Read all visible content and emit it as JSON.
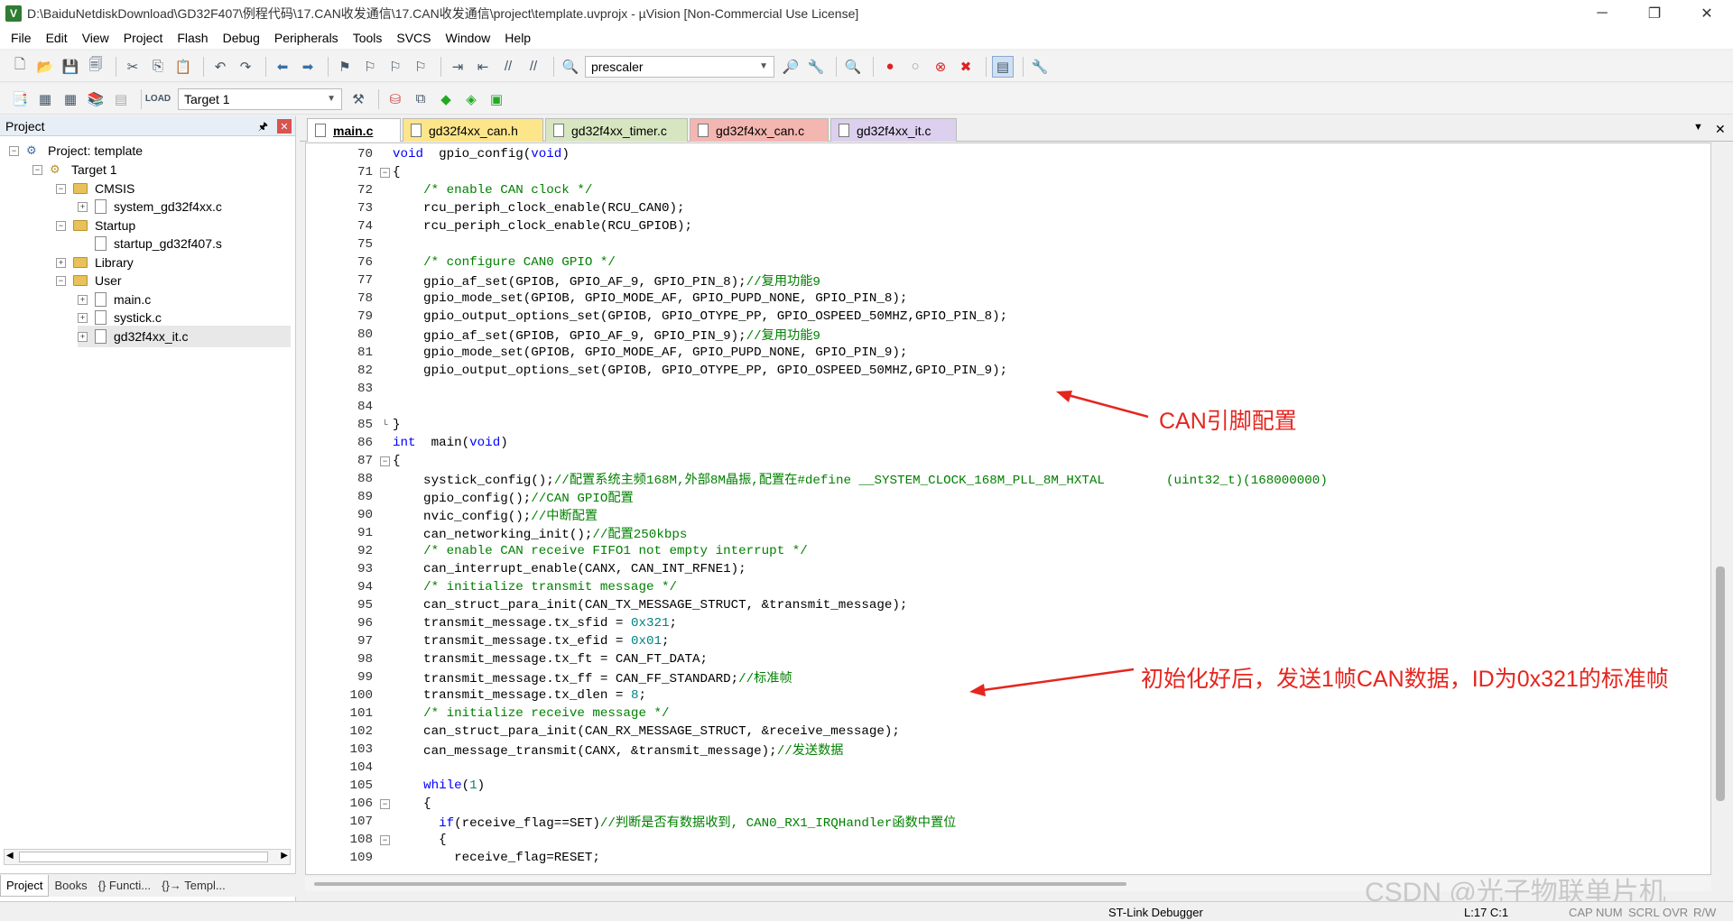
{
  "window": {
    "title": "D:\\BaiduNetdiskDownload\\GD32F407\\例程代码\\17.CAN收发通信\\17.CAN收发通信\\project\\template.uvprojx - µVision  [Non-Commercial Use License]",
    "app_icon": "V",
    "minimize_label": "─",
    "maximize_label": "❐",
    "close_label": "✕"
  },
  "menu": [
    "File",
    "Edit",
    "View",
    "Project",
    "Flash",
    "Debug",
    "Peripherals",
    "Tools",
    "SVCS",
    "Window",
    "Help"
  ],
  "toolbar1": {
    "search_combo_value": "prescaler"
  },
  "toolbar2": {
    "target_combo_value": "Target 1"
  },
  "project_panel": {
    "title": "Project",
    "pin_label": "🖈",
    "close_label": "✕",
    "tree": [
      {
        "label": "Project: template",
        "exp": "−"
      },
      {
        "label": "Target 1",
        "exp": "−"
      },
      {
        "label": "CMSIS",
        "exp": "−"
      },
      {
        "label": "system_gd32f4xx.c",
        "exp": "+"
      },
      {
        "label": "Startup",
        "exp": "−"
      },
      {
        "label": "startup_gd32f407.s",
        "exp": ""
      },
      {
        "label": "Library",
        "exp": "+"
      },
      {
        "label": "User",
        "exp": "−"
      },
      {
        "label": "main.c",
        "exp": "+"
      },
      {
        "label": "systick.c",
        "exp": "+"
      },
      {
        "label": "gd32f4xx_it.c",
        "exp": "+"
      }
    ],
    "bottom_tabs": [
      "Project",
      "Books",
      "{} Functi...",
      "{}→ Templ..."
    ]
  },
  "editor_tabs": [
    {
      "label": "main.c",
      "color": "#ffffff"
    },
    {
      "label": "gd32f4xx_can.h",
      "color": "#fde58a"
    },
    {
      "label": "gd32f4xx_timer.c",
      "color": "#d7e6c0"
    },
    {
      "label": "gd32f4xx_can.c",
      "color": "#f4b6b0"
    },
    {
      "label": "gd32f4xx_it.c",
      "color": "#dcd0ee"
    }
  ],
  "tab_controls": {
    "dropdown": "▼",
    "close": "✕"
  },
  "code_lines": [
    {
      "n": "70",
      "fold": "",
      "segs": [
        [
          "kw",
          "void"
        ],
        [
          "",
          "  gpio_config("
        ],
        [
          "kw",
          "void"
        ],
        [
          "",
          ")"
        ]
      ]
    },
    {
      "n": "71",
      "fold": "−",
      "segs": [
        [
          "",
          "{"
        ]
      ]
    },
    {
      "n": "72",
      "fold": "",
      "segs": [
        [
          "",
          "    "
        ],
        [
          "cm",
          "/* enable CAN clock */"
        ]
      ]
    },
    {
      "n": "73",
      "fold": "",
      "segs": [
        [
          "",
          "    rcu_periph_clock_enable(RCU_CAN0);"
        ]
      ]
    },
    {
      "n": "74",
      "fold": "",
      "segs": [
        [
          "",
          "    rcu_periph_clock_enable(RCU_GPIOB);"
        ]
      ]
    },
    {
      "n": "75",
      "fold": "",
      "segs": [
        [
          "",
          ""
        ]
      ]
    },
    {
      "n": "76",
      "fold": "",
      "segs": [
        [
          "",
          "    "
        ],
        [
          "cm",
          "/* configure CAN0 GPIO */"
        ]
      ]
    },
    {
      "n": "77",
      "fold": "",
      "segs": [
        [
          "",
          "    gpio_af_set(GPIOB, GPIO_AF_9, GPIO_PIN_8);"
        ],
        [
          "cm",
          "//复用功能9"
        ]
      ]
    },
    {
      "n": "78",
      "fold": "",
      "segs": [
        [
          "",
          "    gpio_mode_set(GPIOB, GPIO_MODE_AF, GPIO_PUPD_NONE, GPIO_PIN_8);"
        ]
      ]
    },
    {
      "n": "79",
      "fold": "",
      "segs": [
        [
          "",
          "    gpio_output_options_set(GPIOB, GPIO_OTYPE_PP, GPIO_OSPEED_50MHZ,GPIO_PIN_8);"
        ]
      ]
    },
    {
      "n": "80",
      "fold": "",
      "segs": [
        [
          "",
          "    gpio_af_set(GPIOB, GPIO_AF_9, GPIO_PIN_9);"
        ],
        [
          "cm",
          "//复用功能9"
        ]
      ]
    },
    {
      "n": "81",
      "fold": "",
      "segs": [
        [
          "",
          "    gpio_mode_set(GPIOB, GPIO_MODE_AF, GPIO_PUPD_NONE, GPIO_PIN_9);"
        ]
      ]
    },
    {
      "n": "82",
      "fold": "",
      "segs": [
        [
          "",
          "    gpio_output_options_set(GPIOB, GPIO_OTYPE_PP, GPIO_OSPEED_50MHZ,GPIO_PIN_9);"
        ]
      ]
    },
    {
      "n": "83",
      "fold": "",
      "segs": [
        [
          "",
          ""
        ]
      ]
    },
    {
      "n": "84",
      "fold": "",
      "segs": [
        [
          "",
          ""
        ]
      ]
    },
    {
      "n": "85",
      "fold": "└",
      "segs": [
        [
          "",
          "}"
        ]
      ]
    },
    {
      "n": "86",
      "fold": "",
      "segs": [
        [
          "kw",
          "int"
        ],
        [
          "",
          "  main("
        ],
        [
          "kw",
          "void"
        ],
        [
          "",
          ")"
        ]
      ]
    },
    {
      "n": "87",
      "fold": "−",
      "segs": [
        [
          "",
          "{"
        ]
      ]
    },
    {
      "n": "88",
      "fold": "",
      "segs": [
        [
          "",
          "    systick_config();"
        ],
        [
          "cm",
          "//配置系统主频168M,外部8M晶振,配置在#define __SYSTEM_CLOCK_168M_PLL_8M_HXTAL        (uint32_t)(168000000)"
        ]
      ]
    },
    {
      "n": "89",
      "fold": "",
      "segs": [
        [
          "",
          "    gpio_config();"
        ],
        [
          "cm",
          "//CAN GPIO配置"
        ]
      ]
    },
    {
      "n": "90",
      "fold": "",
      "segs": [
        [
          "",
          "    nvic_config();"
        ],
        [
          "cm",
          "//中断配置"
        ]
      ]
    },
    {
      "n": "91",
      "fold": "",
      "segs": [
        [
          "",
          "    can_networking_init();"
        ],
        [
          "cm",
          "//配置250kbps"
        ]
      ]
    },
    {
      "n": "92",
      "fold": "",
      "segs": [
        [
          "",
          "    "
        ],
        [
          "cm",
          "/* enable CAN receive FIFO1 not empty interrupt */"
        ]
      ]
    },
    {
      "n": "93",
      "fold": "",
      "segs": [
        [
          "",
          "    can_interrupt_enable(CANX, CAN_INT_RFNE1);"
        ]
      ]
    },
    {
      "n": "94",
      "fold": "",
      "segs": [
        [
          "",
          "    "
        ],
        [
          "cm",
          "/* initialize transmit message */"
        ]
      ]
    },
    {
      "n": "95",
      "fold": "",
      "segs": [
        [
          "",
          "    can_struct_para_init(CAN_TX_MESSAGE_STRUCT, &transmit_message);"
        ]
      ]
    },
    {
      "n": "96",
      "fold": "",
      "segs": [
        [
          "",
          "    transmit_message.tx_sfid = "
        ],
        [
          "num",
          "0x321"
        ],
        [
          "",
          ";"
        ]
      ]
    },
    {
      "n": "97",
      "fold": "",
      "segs": [
        [
          "",
          "    transmit_message.tx_efid = "
        ],
        [
          "num",
          "0x01"
        ],
        [
          "",
          ";"
        ]
      ]
    },
    {
      "n": "98",
      "fold": "",
      "segs": [
        [
          "",
          "    transmit_message.tx_ft = CAN_FT_DATA;"
        ]
      ]
    },
    {
      "n": "99",
      "fold": "",
      "segs": [
        [
          "",
          "    transmit_message.tx_ff = CAN_FF_STANDARD;"
        ],
        [
          "cm",
          "//标准帧"
        ]
      ]
    },
    {
      "n": "100",
      "fold": "",
      "segs": [
        [
          "",
          "    transmit_message.tx_dlen = "
        ],
        [
          "num",
          "8"
        ],
        [
          "",
          ";"
        ]
      ]
    },
    {
      "n": "101",
      "fold": "",
      "segs": [
        [
          "",
          "    "
        ],
        [
          "cm",
          "/* initialize receive message */"
        ]
      ]
    },
    {
      "n": "102",
      "fold": "",
      "segs": [
        [
          "",
          "    can_struct_para_init(CAN_RX_MESSAGE_STRUCT, &receive_message);"
        ]
      ]
    },
    {
      "n": "103",
      "fold": "",
      "segs": [
        [
          "",
          "    can_message_transmit(CANX, &transmit_message);"
        ],
        [
          "cm",
          "//发送数据"
        ]
      ]
    },
    {
      "n": "104",
      "fold": "",
      "segs": [
        [
          "",
          ""
        ]
      ]
    },
    {
      "n": "105",
      "fold": "",
      "segs": [
        [
          "",
          "    "
        ],
        [
          "kw",
          "while"
        ],
        [
          "",
          "("
        ],
        [
          "num",
          "1"
        ],
        [
          "",
          ")"
        ]
      ]
    },
    {
      "n": "106",
      "fold": "−",
      "segs": [
        [
          "",
          "    {"
        ]
      ]
    },
    {
      "n": "107",
      "fold": "",
      "segs": [
        [
          "",
          "      "
        ],
        [
          "kw",
          "if"
        ],
        [
          "",
          "(receive_flag==SET)"
        ],
        [
          "cm",
          "//判断是否有数据收到, CAN0_RX1_IRQHandler函数中置位"
        ]
      ]
    },
    {
      "n": "108",
      "fold": "−",
      "segs": [
        [
          "",
          "      {"
        ]
      ]
    },
    {
      "n": "109",
      "fold": "",
      "segs": [
        [
          "",
          "        receive_flag=RESET;"
        ]
      ]
    }
  ],
  "annotations": {
    "pin_config": "CAN引脚配置",
    "send_note": "初始化好后，发送1帧CAN数据，ID为0x321的标准帧"
  },
  "watermark": "CSDN @光子物联单片机",
  "status_bar": {
    "debugger": "ST-Link Debugger",
    "position": "L:17 C:1",
    "caps": "CAP",
    "num": "NUM",
    "scrl": "SCRL",
    "ovr": "OVR",
    "rw": "R/W"
  },
  "colors": {
    "annotation": "#e5261f",
    "keyword": "#0000ff",
    "comment": "#008000",
    "number": "#008080"
  }
}
